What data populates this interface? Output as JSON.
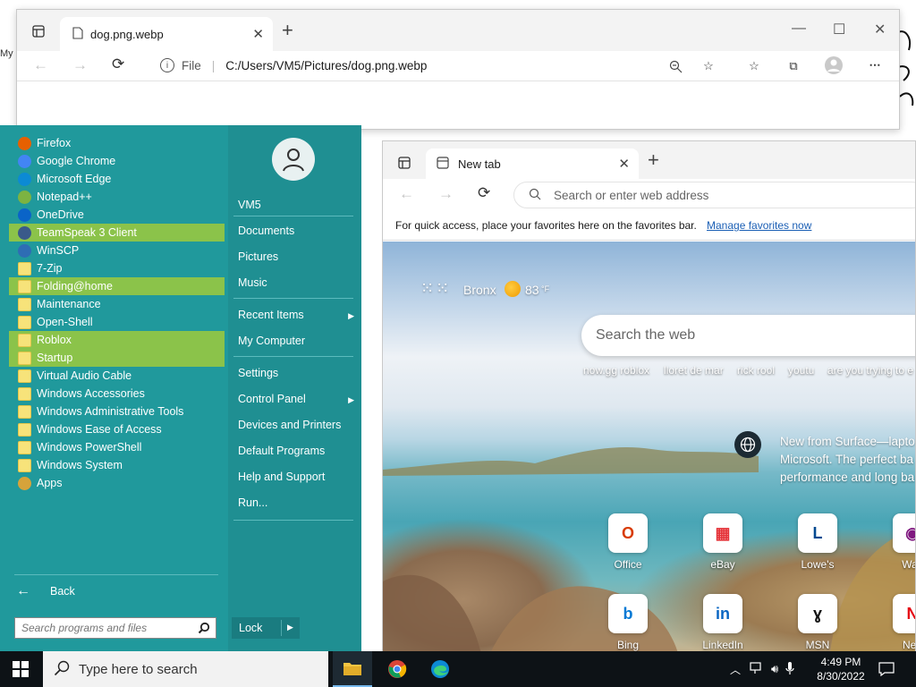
{
  "desktop": {
    "label": "My"
  },
  "window1": {
    "tab_title": "dog.png.webp",
    "address_prefix": "File",
    "address": "C:/Users/VM5/Pictures/dog.png.webp"
  },
  "start_menu": {
    "programs": [
      {
        "label": "Firefox",
        "icon": "firefox-icon",
        "color": "#e66000",
        "highlighted": false
      },
      {
        "label": "Google Chrome",
        "icon": "chrome-icon",
        "color": "#4285f4",
        "highlighted": false
      },
      {
        "label": "Microsoft Edge",
        "icon": "edge-icon",
        "color": "#0c8ad4",
        "highlighted": false
      },
      {
        "label": "Notepad++",
        "icon": "notepadpp-icon",
        "color": "#7cb342",
        "highlighted": false
      },
      {
        "label": "OneDrive",
        "icon": "onedrive-icon",
        "color": "#0a64c8",
        "highlighted": false
      },
      {
        "label": "TeamSpeak 3 Client",
        "icon": "teamspeak-icon",
        "color": "#3a5a8a",
        "highlighted": true
      },
      {
        "label": "WinSCP",
        "icon": "winscp-icon",
        "color": "#2e6db4",
        "highlighted": false
      },
      {
        "label": "7-Zip",
        "icon": "folder-icon",
        "color": "#f7e37a",
        "highlighted": false
      },
      {
        "label": "Folding@home",
        "icon": "folder-icon",
        "color": "#f7e37a",
        "highlighted": true
      },
      {
        "label": "Maintenance",
        "icon": "folder-icon",
        "color": "#f7e37a",
        "highlighted": false
      },
      {
        "label": "Open-Shell",
        "icon": "folder-icon",
        "color": "#f7e37a",
        "highlighted": false
      },
      {
        "label": "Roblox",
        "icon": "folder-icon",
        "color": "#f7e37a",
        "highlighted": true
      },
      {
        "label": "Startup",
        "icon": "folder-icon",
        "color": "#f7e37a",
        "highlighted": true
      },
      {
        "label": "Virtual Audio Cable",
        "icon": "folder-icon",
        "color": "#f7e37a",
        "highlighted": false
      },
      {
        "label": "Windows Accessories",
        "icon": "folder-icon",
        "color": "#f7e37a",
        "highlighted": false
      },
      {
        "label": "Windows Administrative Tools",
        "icon": "folder-icon",
        "color": "#f7e37a",
        "highlighted": false
      },
      {
        "label": "Windows Ease of Access",
        "icon": "folder-icon",
        "color": "#f7e37a",
        "highlighted": false
      },
      {
        "label": "Windows PowerShell",
        "icon": "folder-icon",
        "color": "#f7e37a",
        "highlighted": false
      },
      {
        "label": "Windows System",
        "icon": "folder-icon",
        "color": "#f7e37a",
        "highlighted": false
      },
      {
        "label": "Apps",
        "icon": "apps-icon",
        "color": "#d6a33a",
        "highlighted": false
      }
    ],
    "right_links": [
      {
        "label": "VM5",
        "submenu": false
      },
      {
        "label": "Documents",
        "submenu": false
      },
      {
        "label": "Pictures",
        "submenu": false
      },
      {
        "label": "Music",
        "submenu": false
      },
      {
        "label": "Recent Items",
        "submenu": true
      },
      {
        "label": "My Computer",
        "submenu": false
      },
      {
        "label": "Settings",
        "submenu": false
      },
      {
        "label": "Control Panel",
        "submenu": true
      },
      {
        "label": "Devices and Printers",
        "submenu": false
      },
      {
        "label": "Default Programs",
        "submenu": false
      },
      {
        "label": "Help and Support",
        "submenu": false
      },
      {
        "label": "Run...",
        "submenu": false
      }
    ],
    "back_label": "Back",
    "search_placeholder": "Search programs and files",
    "lock_label": "Lock",
    "highlight_color": "#8bc34a",
    "panel_color": "#20999c"
  },
  "window2": {
    "tab_title": "New tab",
    "address_placeholder": "Search or enter web address",
    "favorites_text": "For quick access, place your favorites here on the favorites bar.",
    "favorites_link": "Manage favorites now",
    "weather": {
      "location": "Bronx",
      "temp": "83",
      "unit": "°F"
    },
    "search_placeholder": "Search the web",
    "quick_links": [
      "now.gg roblox",
      "lloret de mar",
      "rick rool",
      "youtu",
      "are you trying to e"
    ],
    "news_text": "New from Surface—lapto Microsoft. The perfect ba performance and long ba",
    "tiles": [
      {
        "label": "Office",
        "icon": "office-icon"
      },
      {
        "label": "eBay",
        "icon": "ebay-icon"
      },
      {
        "label": "Lowe's",
        "icon": "lowes-icon"
      },
      {
        "label": "Way",
        "icon": "wayfair-icon"
      },
      {
        "label": "Bing",
        "icon": "bing-icon"
      },
      {
        "label": "LinkedIn",
        "icon": "linkedin-icon"
      },
      {
        "label": "MSN",
        "icon": "msn-icon"
      },
      {
        "label": "Netf",
        "icon": "netflix-icon"
      }
    ]
  },
  "taskbar": {
    "search_placeholder": "Type here to search",
    "time": "4:49 PM",
    "date": "8/30/2022"
  }
}
